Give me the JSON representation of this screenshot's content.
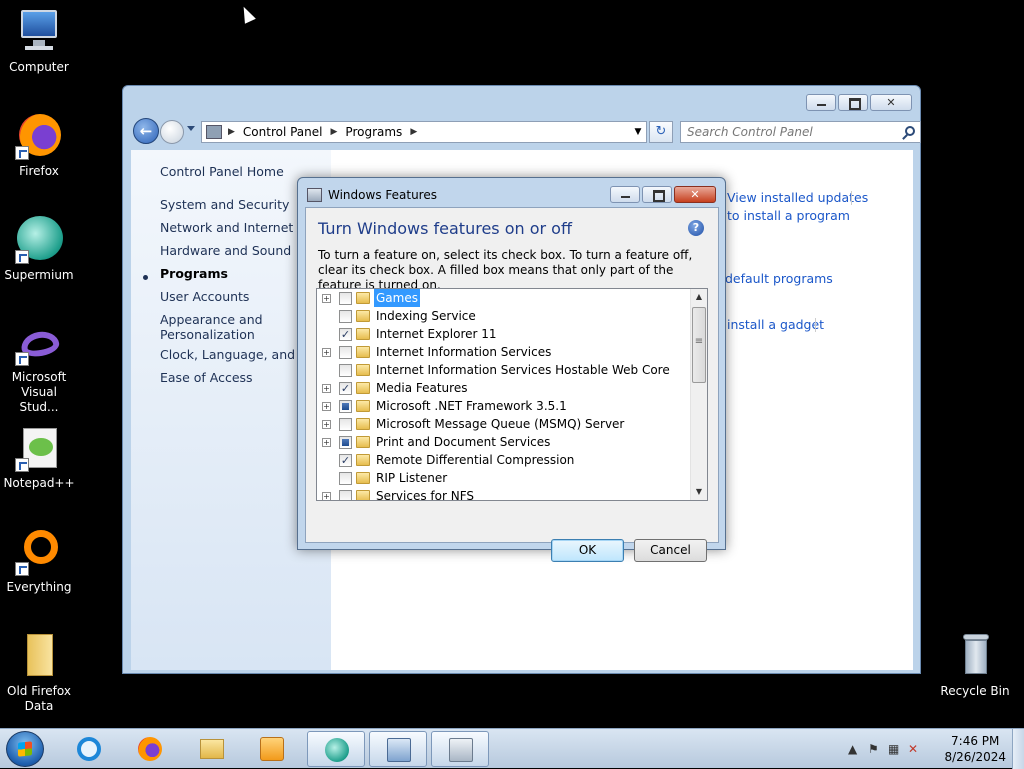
{
  "desktop": {
    "icons": [
      {
        "label": "Computer"
      },
      {
        "label": "Firefox"
      },
      {
        "label": "Supermium"
      },
      {
        "label": "Microsoft Visual Stud..."
      },
      {
        "label": "Notepad++"
      },
      {
        "label": "Everything"
      },
      {
        "label": "Old Firefox Data"
      },
      {
        "label": "Recycle Bin"
      }
    ]
  },
  "control_panel": {
    "breadcrumb": [
      "Control Panel",
      "Programs"
    ],
    "search_placeholder": "Search Control Panel",
    "sidebar": [
      {
        "label": "Control Panel Home"
      },
      {
        "label": "System and Security"
      },
      {
        "label": "Network and Internet"
      },
      {
        "label": "Hardware and Sound"
      },
      {
        "label": "Programs",
        "current": true
      },
      {
        "label": "User Accounts"
      },
      {
        "label": "Appearance and Personalization"
      },
      {
        "label": "Clock, Language, and Reg"
      },
      {
        "label": "Ease of Access"
      }
    ],
    "main_links": [
      "View installed updates",
      "to install a program",
      "default programs",
      "install a gadget"
    ]
  },
  "dialog": {
    "title": "Windows Features",
    "heading": "Turn Windows features on or off",
    "description": "To turn a feature on, select its check box. To turn a feature off, clear its check box. A filled box means that only part of the feature is turned on.",
    "features": [
      {
        "label": "Games",
        "expandable": true,
        "state": "unchecked",
        "selected": true
      },
      {
        "label": "Indexing Service",
        "expandable": false,
        "state": "unchecked"
      },
      {
        "label": "Internet Explorer 11",
        "expandable": false,
        "state": "checked"
      },
      {
        "label": "Internet Information Services",
        "expandable": true,
        "state": "unchecked"
      },
      {
        "label": "Internet Information Services Hostable Web Core",
        "expandable": false,
        "state": "unchecked"
      },
      {
        "label": "Media Features",
        "expandable": true,
        "state": "checked"
      },
      {
        "label": "Microsoft .NET Framework 3.5.1",
        "expandable": true,
        "state": "partial"
      },
      {
        "label": "Microsoft Message Queue (MSMQ) Server",
        "expandable": true,
        "state": "unchecked"
      },
      {
        "label": "Print and Document Services",
        "expandable": true,
        "state": "partial"
      },
      {
        "label": "Remote Differential Compression",
        "expandable": false,
        "state": "checked"
      },
      {
        "label": "RIP Listener",
        "expandable": false,
        "state": "unchecked"
      },
      {
        "label": "Services for NFS",
        "expandable": true,
        "state": "unchecked"
      }
    ],
    "ok_label": "OK",
    "cancel_label": "Cancel",
    "help_glyph": "?"
  },
  "taskbar": {
    "apps": [
      "internet-explorer",
      "firefox",
      "file-explorer",
      "media-player",
      "supermium",
      "control-panel",
      "windows-features"
    ],
    "clock_time": "7:46 PM",
    "clock_date": "8/26/2024"
  }
}
